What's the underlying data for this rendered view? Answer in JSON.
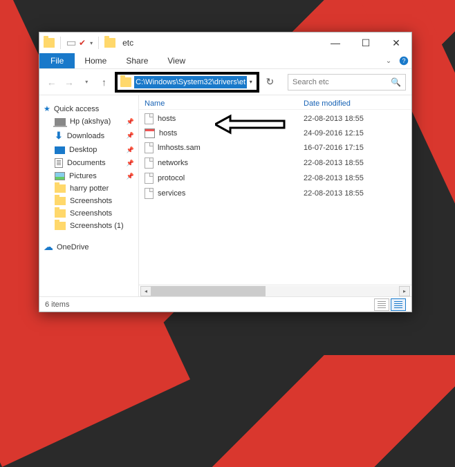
{
  "titlebar": {
    "title": "etc"
  },
  "ribbon": {
    "file": "File",
    "tabs": [
      "Home",
      "Share",
      "View"
    ]
  },
  "address": {
    "path": "C:\\Windows\\System32\\drivers\\etc"
  },
  "search": {
    "placeholder": "Search etc"
  },
  "sidebar": {
    "quick_access": "Quick access",
    "items": [
      {
        "label": "Hp (akshya)",
        "icon": "laptop",
        "pinned": true
      },
      {
        "label": "Downloads",
        "icon": "download",
        "pinned": true
      },
      {
        "label": "Desktop",
        "icon": "desktop",
        "pinned": true
      },
      {
        "label": "Documents",
        "icon": "document",
        "pinned": true
      },
      {
        "label": "Pictures",
        "icon": "pictures",
        "pinned": true
      },
      {
        "label": "harry potter",
        "icon": "folder",
        "pinned": false
      },
      {
        "label": "Screenshots",
        "icon": "folder",
        "pinned": false
      },
      {
        "label": "Screenshots",
        "icon": "folder",
        "pinned": false
      },
      {
        "label": "Screenshots (1)",
        "icon": "folder",
        "pinned": false
      }
    ],
    "onedrive": "OneDrive"
  },
  "columns": {
    "name": "Name",
    "date": "Date modified"
  },
  "files": [
    {
      "name": "hosts",
      "icon": "file",
      "date": "22-08-2013 18:55"
    },
    {
      "name": "hosts",
      "icon": "table",
      "date": "24-09-2016 12:15"
    },
    {
      "name": "lmhosts.sam",
      "icon": "file",
      "date": "16-07-2016 17:15"
    },
    {
      "name": "networks",
      "icon": "file",
      "date": "22-08-2013 18:55"
    },
    {
      "name": "protocol",
      "icon": "file",
      "date": "22-08-2013 18:55"
    },
    {
      "name": "services",
      "icon": "file",
      "date": "22-08-2013 18:55"
    }
  ],
  "status": {
    "count": "6 items"
  }
}
